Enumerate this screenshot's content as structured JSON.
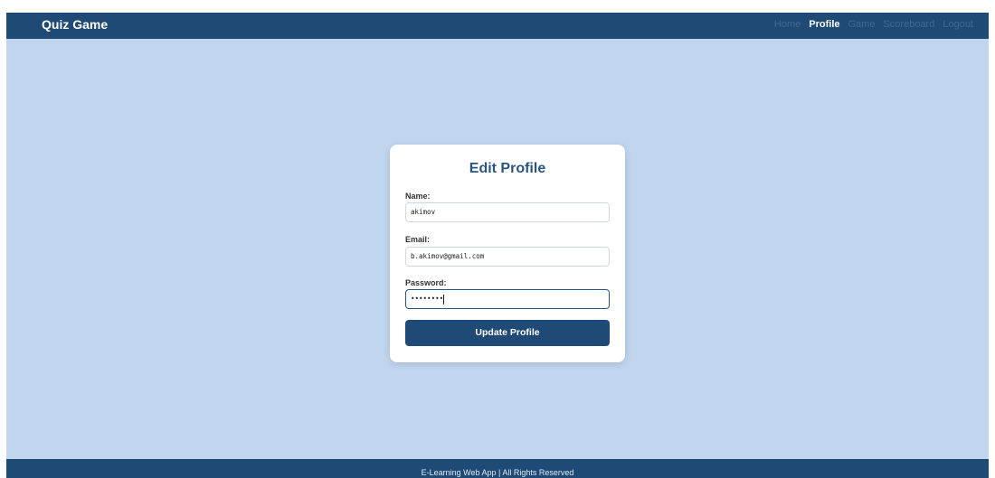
{
  "navbar": {
    "brand": "Quiz Game",
    "links": [
      "Home",
      "Profile",
      "Game",
      "Scoreboard",
      "Logout"
    ],
    "active": "Profile"
  },
  "form": {
    "title": "Edit Profile",
    "name_label": "Name:",
    "name_value": "akimov",
    "email_label": "Email:",
    "email_value": "b.akimov@gmail.com",
    "password_label": "Password:",
    "password_value": "••••••••",
    "submit_label": "Update Profile"
  },
  "footer": {
    "text": "E-Learning Web App | All Rights Reserved"
  },
  "colors": {
    "navbar_bg": "#1f4a75",
    "page_bg": "#c1d5ee",
    "title": "#2a5580",
    "nav_inactive": "#3c6a96",
    "nav_active": "#ffffff"
  }
}
